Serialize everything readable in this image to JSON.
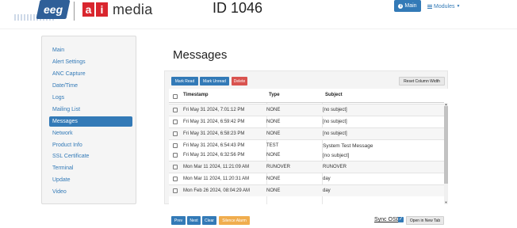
{
  "header": {
    "logo_eeg": "eeg",
    "logo_ai": [
      "a",
      "i"
    ],
    "logo_media": "media",
    "title": "ID 1046",
    "main_button": "Main",
    "modules_button": "Modules"
  },
  "sidebar": {
    "items": [
      {
        "label": "Main"
      },
      {
        "label": "Alert Settings"
      },
      {
        "label": "ANC Capture"
      },
      {
        "label": "Date/Time"
      },
      {
        "label": "Logs"
      },
      {
        "label": "Mailing List"
      },
      {
        "label": "Messages",
        "active": true
      },
      {
        "label": "Network"
      },
      {
        "label": "Product Info"
      },
      {
        "label": "SSL Certificate"
      },
      {
        "label": "Terminal"
      },
      {
        "label": "Update"
      },
      {
        "label": "Video"
      }
    ]
  },
  "main": {
    "title": "Messages",
    "toolbar": {
      "mark_read": "Mark Read",
      "mark_unread": "Mark Unread",
      "delete": "Delete",
      "reset_width": "Reset Column Width"
    },
    "table": {
      "headers": [
        "Timestamp",
        "Type",
        "Subject"
      ],
      "rows": [
        {
          "timestamp": "Fri May 31 2024, 7:01:12 PM",
          "type": "NONE",
          "subject": "[no subject]"
        },
        {
          "timestamp": "Fri May 31 2024, 6:59:42 PM",
          "type": "NONE",
          "subject": "[no subject]"
        },
        {
          "timestamp": "Fri May 31 2024, 6:58:23 PM",
          "type": "NONE",
          "subject": "[no subject]"
        },
        {
          "timestamp": "Fri May 31 2024, 6:54:43 PM",
          "type": "TEST",
          "subject": "System Test Message"
        },
        {
          "timestamp": "Fri May 31 2024, 6:32:56 PM",
          "type": "NONE",
          "subject": "[no subject]"
        },
        {
          "timestamp": "Mon Mar 11 2024, 11:21:09 AM",
          "type": "RUNOVER",
          "subject": "RUNOVER"
        },
        {
          "timestamp": "Mon Mar 11 2024, 11:20:31 AM",
          "type": "NONE",
          "subject": "day"
        },
        {
          "timestamp": "Mon Feb 26 2024, 08:04:29 AM",
          "type": "NONE",
          "subject": "day"
        }
      ]
    },
    "footer": {
      "prev": "Prev",
      "next": "Next",
      "clear": "Clear",
      "silence": "Silence Alarm",
      "sync_label": "Sync OSD",
      "sync_checked": true,
      "open_new_tab": "Open in New Tab"
    }
  },
  "colors": {
    "primary": "#337ab7",
    "danger": "#d9534f",
    "warning": "#f0ad4e",
    "logo_blue": "#2f5f98",
    "logo_red": "#d9262e"
  }
}
